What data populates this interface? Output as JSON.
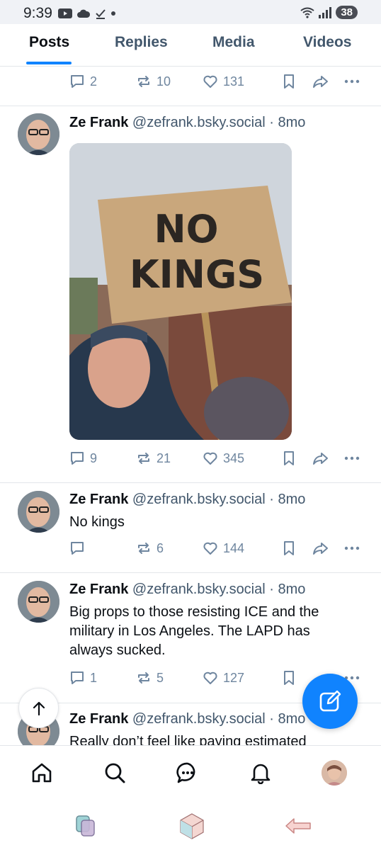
{
  "status_bar": {
    "time": "9:39",
    "battery": "38"
  },
  "tabs": [
    {
      "label": "Posts",
      "active": true
    },
    {
      "label": "Replies",
      "active": false
    },
    {
      "label": "Media",
      "active": false
    },
    {
      "label": "Videos",
      "active": false
    }
  ],
  "posts": [
    {
      "replies": "2",
      "reposts": "10",
      "likes": "131"
    },
    {
      "name": "Ze Frank",
      "handle": "@zefrank.bsky.social",
      "time": "· 8mo",
      "image_text": "NO KINGS",
      "replies": "9",
      "reposts": "21",
      "likes": "345"
    },
    {
      "name": "Ze Frank",
      "handle": "@zefrank.bsky.social",
      "time": "· 8mo",
      "text": "No kings",
      "replies": "",
      "reposts": "6",
      "likes": "144"
    },
    {
      "name": "Ze Frank",
      "handle": "@zefrank.bsky.social",
      "time": "· 8mo",
      "text": "Big props to those resisting ICE and the military in Los Angeles. The LAPD has always sucked.",
      "replies": "1",
      "reposts": "5",
      "likes": "127"
    },
    {
      "name": "Ze Frank",
      "handle": "@zefrank.bsky.social",
      "time": "· 8mo",
      "text": "Really don’t feel like paying estimated"
    }
  ],
  "colors": {
    "accent": "#1083fe",
    "muted": "#6f869f",
    "handle": "#42576c"
  },
  "icons": [
    "comment-icon",
    "repost-icon",
    "heart-icon",
    "bookmark-icon",
    "share-icon",
    "more-icon",
    "home-icon",
    "search-icon",
    "chat-icon",
    "bell-icon",
    "compose-icon",
    "arrow-up-icon"
  ]
}
